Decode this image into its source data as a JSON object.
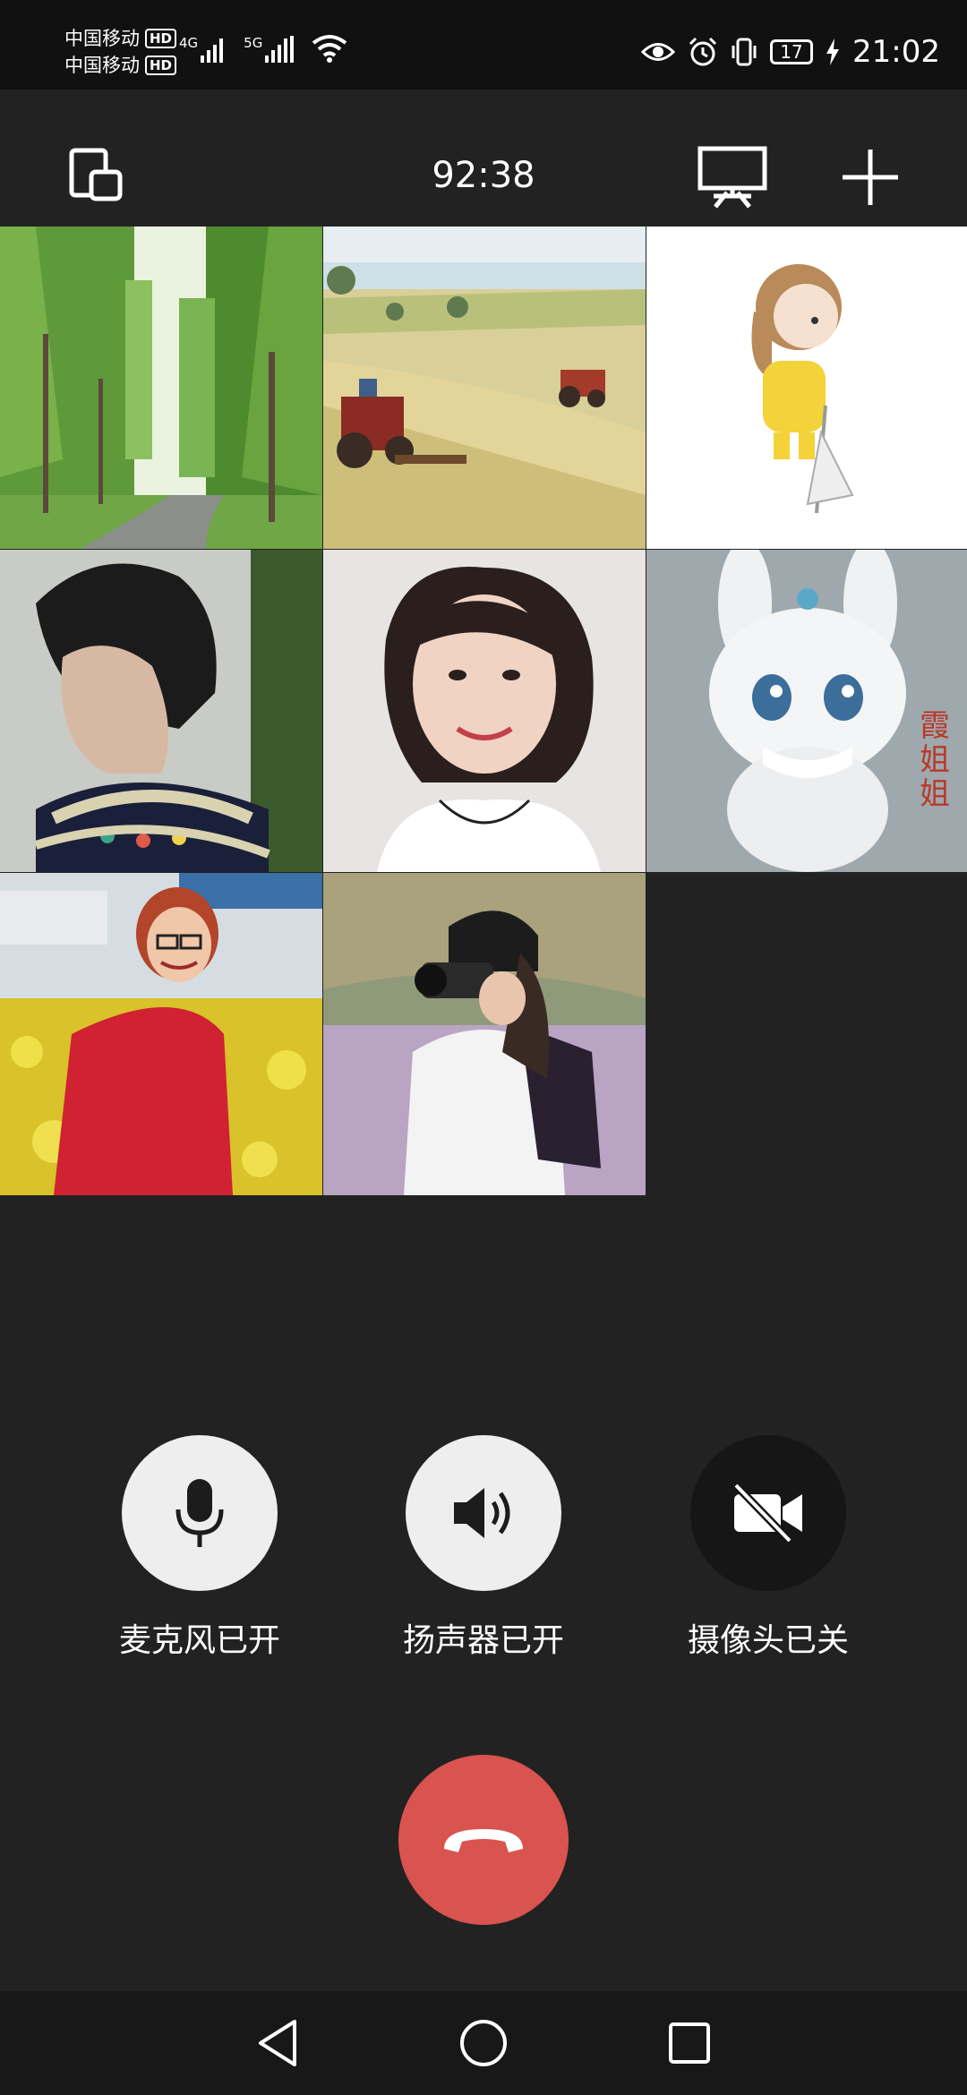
{
  "status_bar": {
    "carrier1": "中国移动",
    "carrier2": "中国移动",
    "hd": "HD",
    "net1": "4G",
    "net2": "5G",
    "battery_level": "17",
    "time": "21:02"
  },
  "top_bar": {
    "duration": "92:38",
    "icons": [
      "switch-window-icon",
      "screen-share-icon",
      "add-icon"
    ]
  },
  "participants": [
    {
      "desc_icon": "avatar",
      "theme": "forest-road"
    },
    {
      "desc_icon": "avatar",
      "theme": "tractor-field"
    },
    {
      "desc_icon": "avatar",
      "theme": "cartoon-girl"
    },
    {
      "desc_icon": "avatar",
      "theme": "woman-profile"
    },
    {
      "desc_icon": "avatar",
      "theme": "woman-smiling"
    },
    {
      "desc_icon": "avatar",
      "theme": "white-rabbit"
    },
    {
      "desc_icon": "avatar",
      "theme": "woman-flowers"
    },
    {
      "desc_icon": "avatar",
      "theme": "photographer"
    }
  ],
  "rabbit_text": "霞姐姐",
  "controls": {
    "mic": {
      "label": "麦克风已开",
      "icon": "microphone-icon"
    },
    "speaker": {
      "label": "扬声器已开",
      "icon": "speaker-icon"
    },
    "camera": {
      "label": "摄像头已关",
      "icon": "camera-off-icon"
    }
  },
  "hangup": {
    "icon": "hang-up-icon"
  },
  "colors": {
    "background": "#222222",
    "control_on": "#eeeeee",
    "control_off": "#161616",
    "hangup": "#d9534f"
  },
  "nav": [
    "back-icon",
    "home-icon",
    "recents-icon"
  ]
}
